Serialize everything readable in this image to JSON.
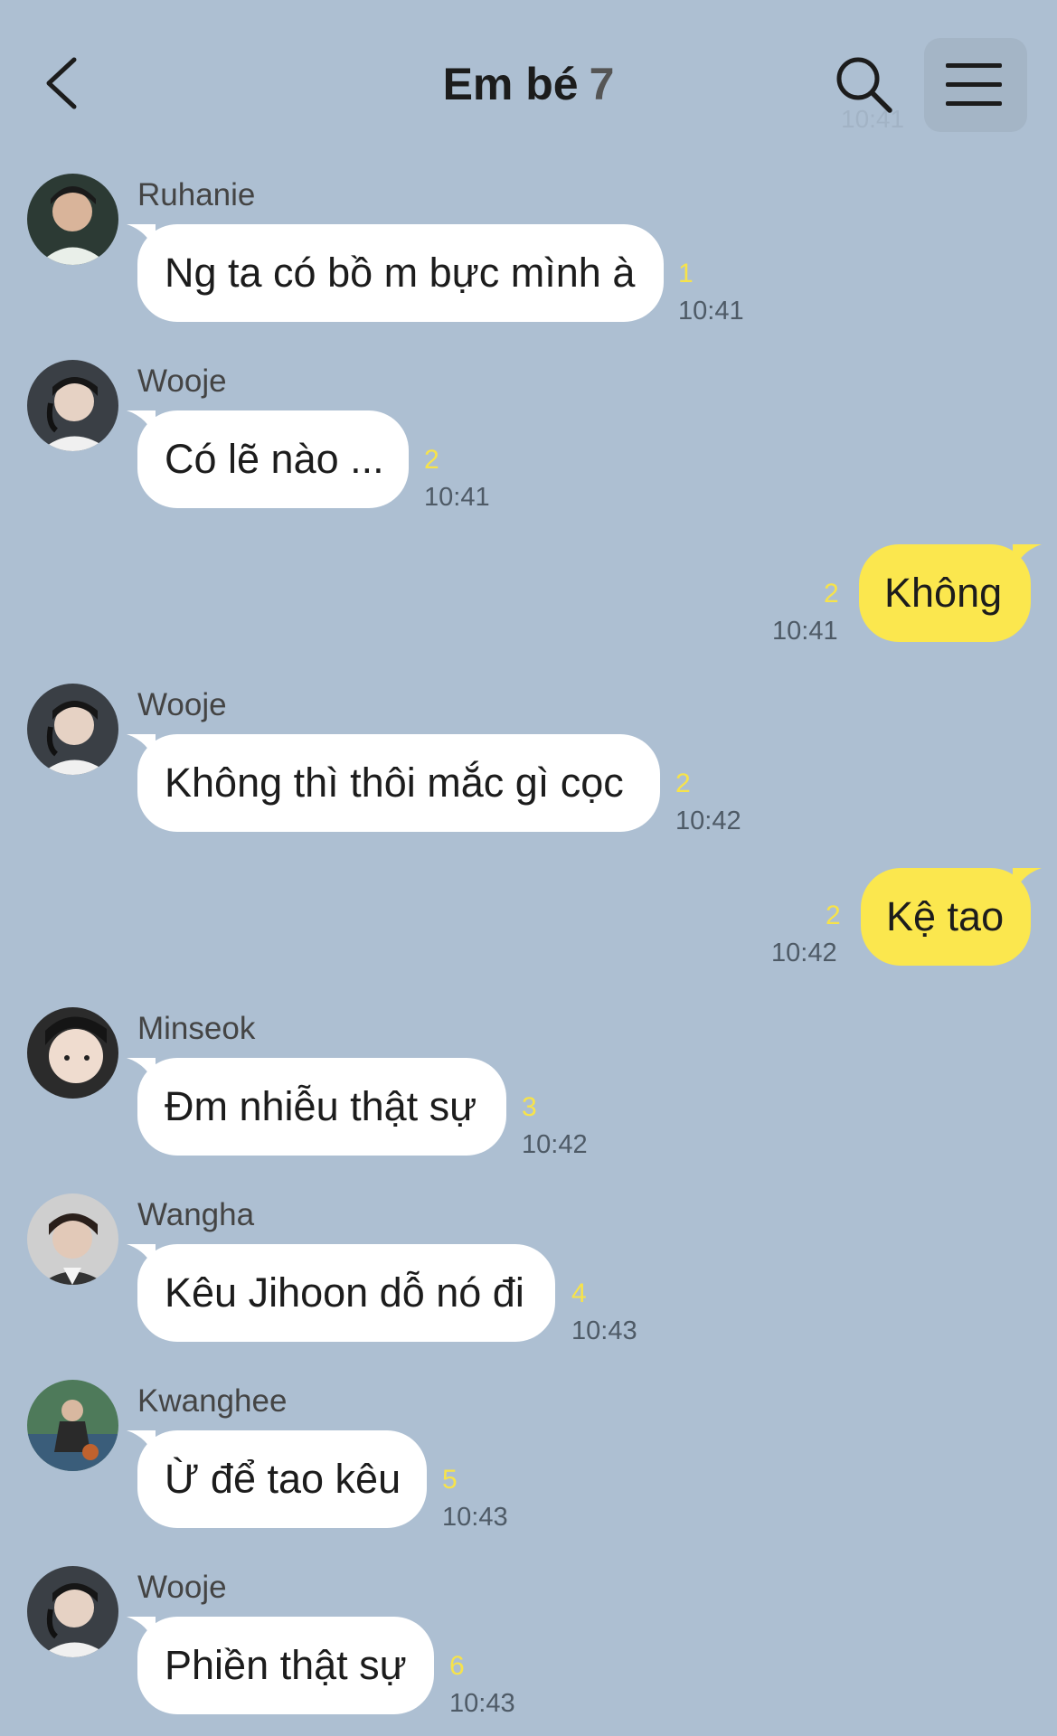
{
  "header": {
    "title": "Em bé",
    "member_count": "7",
    "ghost_time": "10:41",
    "back_icon": "chevron-left-icon",
    "search_icon": "search-icon",
    "menu_icon": "menu-icon"
  },
  "colors": {
    "background": "#adbfd2",
    "incoming_bubble": "#ffffff",
    "outgoing_bubble": "#fbe74e",
    "unread_count": "#f7e34a"
  },
  "messages": [
    {
      "sender": "Ruhanie",
      "text": "Ng ta có bồ m bực mình à",
      "unread": "1",
      "time": "10:41"
    },
    {
      "sender": "Wooje",
      "text": "Có lẽ nào ...",
      "unread": "2",
      "time": "10:41"
    },
    {
      "sender": "",
      "text": "Không",
      "unread": "2",
      "time": "10:41"
    },
    {
      "sender": "Wooje",
      "text": "Không thì thôi mắc gì cọc",
      "unread": "2",
      "time": "10:42"
    },
    {
      "sender": "",
      "text": "Kệ tao",
      "unread": "2",
      "time": "10:42"
    },
    {
      "sender": "Minseok",
      "text": "Đm nhiễu thật sự",
      "unread": "3",
      "time": "10:42"
    },
    {
      "sender": "Wangha",
      "text": "Kêu Jihoon dỗ nó đi",
      "unread": "4",
      "time": "10:43"
    },
    {
      "sender": "Kwanghee",
      "text": "Ừ để tao kêu",
      "unread": "5",
      "time": "10:43"
    },
    {
      "sender": "Wooje",
      "text": "Phiền thật sự",
      "unread": "6",
      "time": "10:43"
    }
  ]
}
